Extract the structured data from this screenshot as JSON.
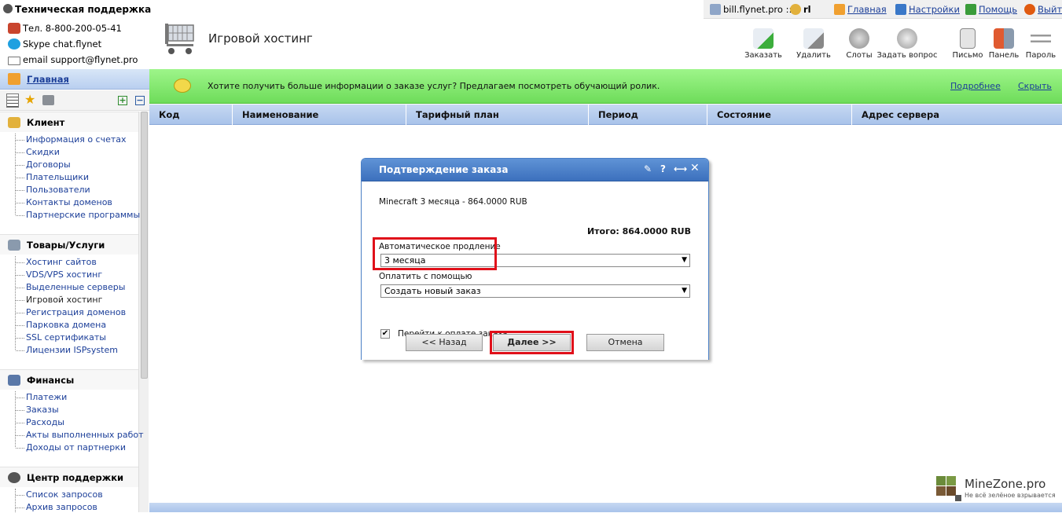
{
  "support": {
    "title": "Техническая поддержка",
    "phone": "Тел. 8-800-200-05-41",
    "skype": "Skype chat.flynet",
    "email": "email support@flynet.pro"
  },
  "topbar": {
    "site": "bill.flynet.pro ::",
    "user": "rl",
    "home": "Главная",
    "settings": "Настройки",
    "help": "Помощь",
    "exit": "Выйти"
  },
  "page_title": "Игровой хостинг",
  "toolbar": {
    "order": "Заказать",
    "delete": "Удалить",
    "slots": "Слоты",
    "ask": "Задать вопрос",
    "letter": "Письмо",
    "panel": "Панель",
    "password": "Пароль"
  },
  "sidebar": {
    "home": "Главная",
    "sections": [
      {
        "title": "Клиент",
        "items": [
          "Информация о счетах",
          "Скидки",
          "Договоры",
          "Плательщики",
          "Пользователи",
          "Контакты доменов",
          "Партнерские программы"
        ]
      },
      {
        "title": "Товары/Услуги",
        "items": [
          "Хостинг сайтов",
          "VDS/VPS хостинг",
          "Выделенные серверы",
          "Игровой хостинг",
          "Регистрация доменов",
          "Парковка домена",
          "SSL сертификаты",
          "Лицензии ISPsystem"
        ]
      },
      {
        "title": "Финансы",
        "items": [
          "Платежи",
          "Заказы",
          "Расходы",
          "Акты выполненных работ",
          "Доходы от партнерки"
        ]
      },
      {
        "title": "Центр поддержки",
        "items": [
          "Список запросов",
          "Архив запросов"
        ]
      }
    ]
  },
  "banner": {
    "message": "Хотите получить больше информации о заказе услуг? Предлагаем посмотреть обучающий ролик.",
    "more": "Подробнее",
    "hide": "Скрыть"
  },
  "table": {
    "columns": [
      "Код",
      "Наименование",
      "Тарифный план",
      "Период",
      "Состояние",
      "Адрес сервера"
    ]
  },
  "dialog": {
    "title": "Подтверждение заказа",
    "product": "Minecraft 3 месяца - 864.0000 RUB",
    "total": "Итого: 864.0000 RUB",
    "autorenew_label": "Автоматическое продление",
    "autorenew_value": "3 месяца",
    "pay_label": "Оплатить с помощью",
    "pay_value": "Создать новый заказ",
    "goto_pay": "Перейти к оплате заказа",
    "back": "<< Назад",
    "next": "Далее >>",
    "cancel": "Отмена"
  },
  "watermark": {
    "brand": "MineZone.pro",
    "tagline": "Не всё зелёное взрывается"
  },
  "colors": {
    "accent": "#3c70bd",
    "banner": "#7fe46a",
    "highlight": "#e0101a"
  }
}
